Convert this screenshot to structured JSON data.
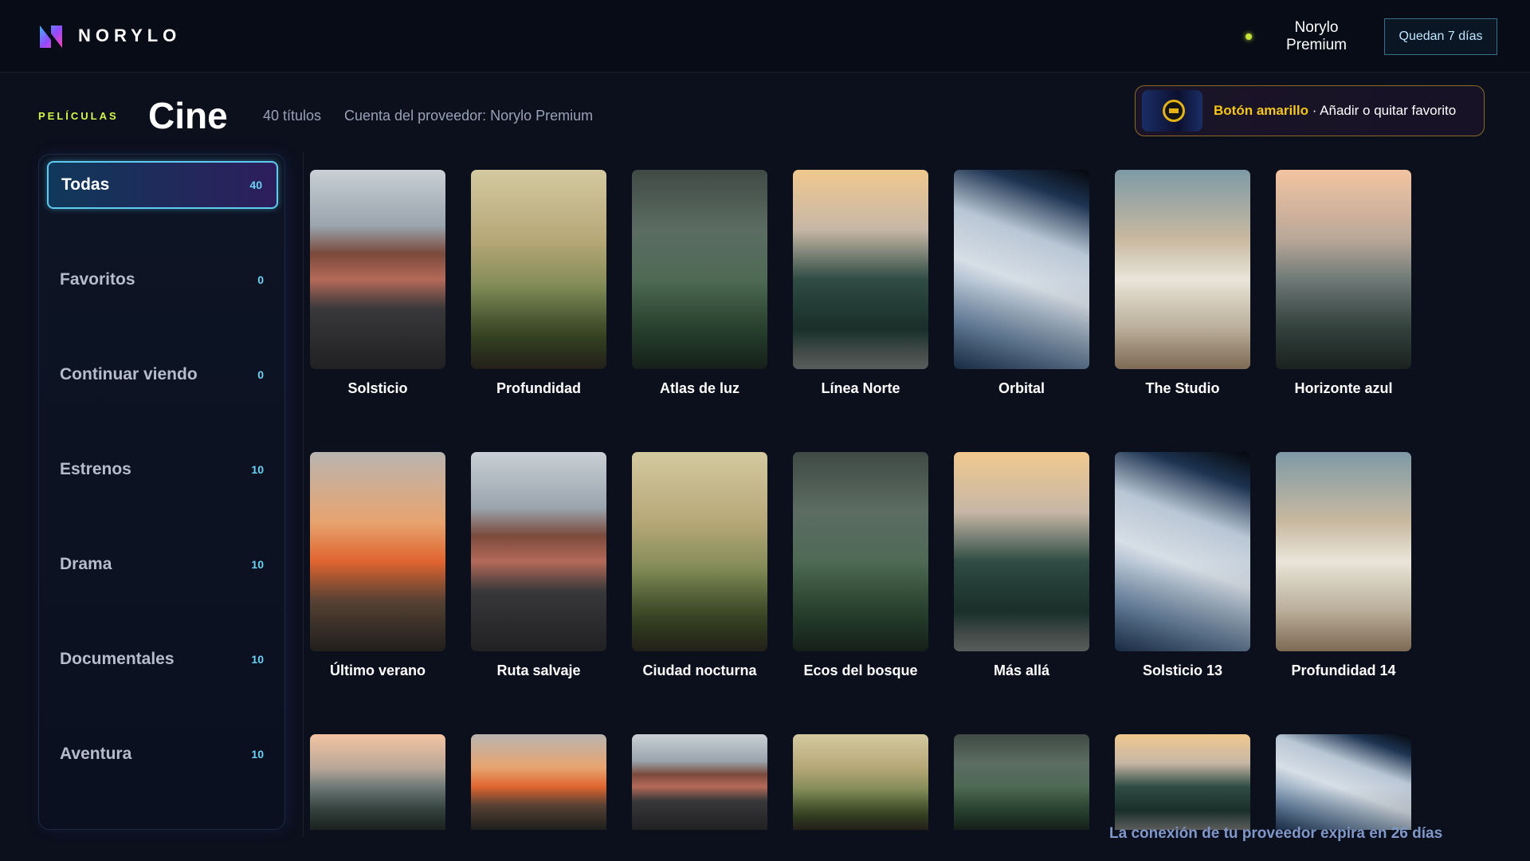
{
  "header": {
    "brand": "NORYLO",
    "logo_icon": "norylo-logo-icon",
    "status_color": "#c6e33a",
    "plan_name": "Norylo Premium",
    "trial_button": "Quedan 7 días"
  },
  "page": {
    "eyebrow": "PELÍCULAS",
    "title": "Cine",
    "count": "40 títulos",
    "account": "Cuenta del proveedor: Norylo Premium"
  },
  "hint": {
    "key": "Botón amarillo",
    "action": " · Añadir o quitar favorito",
    "remote_icon": "remote-control-icon"
  },
  "sidebar": {
    "items": [
      {
        "label": "Todas",
        "count": "40",
        "active": true
      },
      {
        "label": "Favoritos",
        "count": "0"
      },
      {
        "label": "Continuar viendo",
        "count": "0"
      },
      {
        "label": "Estrenos",
        "count": "10"
      },
      {
        "label": "Drama",
        "count": "10"
      },
      {
        "label": "Documentales",
        "count": "10"
      },
      {
        "label": "Aventura",
        "count": "10"
      }
    ]
  },
  "grid": {
    "row1": [
      {
        "title": "Solsticio",
        "art": "road"
      },
      {
        "title": "Profundidad",
        "art": "mount"
      },
      {
        "title": "Atlas de luz",
        "art": "forest"
      },
      {
        "title": "Línea Norte",
        "art": "pines"
      },
      {
        "title": "Orbital",
        "art": "earth"
      },
      {
        "title": "The Studio",
        "art": "studio"
      },
      {
        "title": "Horizonte azul",
        "art": "horizon"
      }
    ],
    "row2": [
      {
        "title": "Último verano",
        "art": "sunset"
      },
      {
        "title": "Ruta salvaje",
        "art": "road"
      },
      {
        "title": "Ciudad nocturna",
        "art": "mount"
      },
      {
        "title": "Ecos del bosque",
        "art": "forest"
      },
      {
        "title": "Más allá",
        "art": "pines"
      },
      {
        "title": "Solsticio 13",
        "art": "earth"
      },
      {
        "title": "Profundidad 14",
        "art": "studio"
      }
    ],
    "row3": [
      {
        "art": "horizon"
      },
      {
        "art": "sunset"
      },
      {
        "art": "road"
      },
      {
        "art": "mount"
      },
      {
        "art": "forest"
      },
      {
        "art": "pines"
      },
      {
        "art": "earth"
      }
    ]
  },
  "footer": {
    "message": "La conexión de tu proveedor expira en 26 días"
  }
}
